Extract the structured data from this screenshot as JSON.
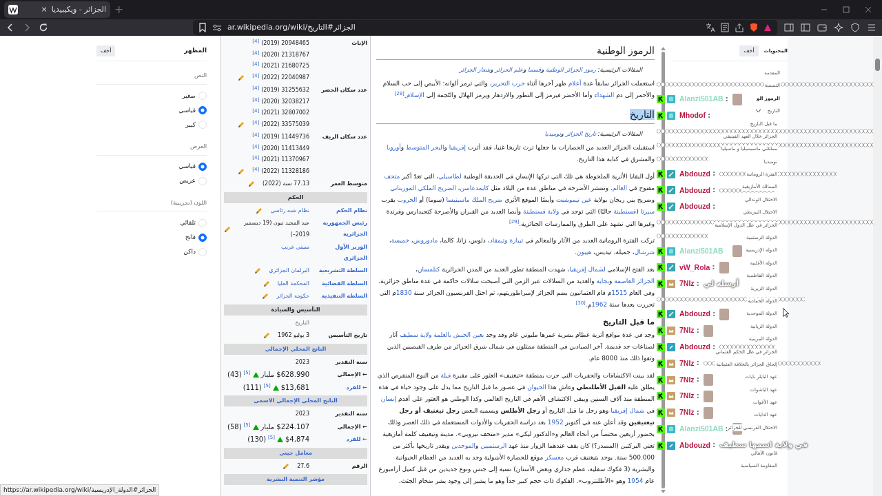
{
  "browser": {
    "tab": {
      "title": "الجزائر - ويكيبيديا",
      "close": "×",
      "new_tab": "+"
    },
    "url": "ar.wikipedia.org/wiki/الجزائر#التاريخ"
  },
  "appearance": {
    "title": "المظهر",
    "hide": "أخف",
    "groups": [
      {
        "title": "النص",
        "options": [
          {
            "label": "صغير",
            "selected": false
          },
          {
            "label": "قياسي",
            "selected": true
          },
          {
            "label": "كبير",
            "selected": false
          }
        ]
      },
      {
        "title": "العرض",
        "options": [
          {
            "label": "قياسي",
            "selected": true
          },
          {
            "label": "عريض",
            "selected": false
          }
        ]
      },
      {
        "title": "اللون (تجريبية)",
        "options": [
          {
            "label": "تلقائي",
            "selected": false
          },
          {
            "label": "فاتح",
            "selected": true
          },
          {
            "label": "داكن",
            "selected": false
          }
        ]
      }
    ]
  },
  "infobox": [
    {
      "kind": "row",
      "label": "الإناث",
      "values": [
        {
          "text": "20948465 (2019)",
          "ref": "[4]"
        },
        {
          "text": "21318767 (2020)",
          "ref": "[4]"
        },
        {
          "text": "21680725 (2021)",
          "ref": "[4]"
        },
        {
          "text": "22040987 (2022)",
          "ref": "[4]"
        }
      ],
      "edit": true
    },
    {
      "kind": "row",
      "label": "عدد سكان الحضر",
      "values": [
        {
          "text": "31255632 (2019)",
          "ref": "[4]"
        },
        {
          "text": "32038217 (2020)",
          "ref": "[4]"
        },
        {
          "text": "32807002 (2021)",
          "ref": "[4]"
        },
        {
          "text": "33575039 (2022)",
          "ref": "[4]"
        }
      ],
      "edit": true
    },
    {
      "kind": "row",
      "label": "عدد سكان الريف",
      "values": [
        {
          "text": "11449736 (2019)",
          "ref": "[4]"
        },
        {
          "text": "11413449 (2020)",
          "ref": "[4]"
        },
        {
          "text": "11370967 (2021)",
          "ref": "[4]"
        },
        {
          "text": "11328186 (2022)",
          "ref": "[4]"
        }
      ],
      "edit": true
    },
    {
      "kind": "row",
      "label": "متوسط العمر",
      "values": [
        {
          "text": "77.13 سنة (2022)"
        }
      ],
      "edit": true
    },
    {
      "kind": "header",
      "label": "الحكم",
      "link": false
    },
    {
      "kind": "row",
      "label": "نظام الحكم",
      "label_link": true,
      "values": [
        {
          "text": "نظام شبه رئاسي",
          "link": true
        }
      ],
      "edit": true
    },
    {
      "kind": "row",
      "label": "رئيس الجمهورية الجزائرية",
      "label_link": true,
      "values": [
        {
          "text": "عبد المجيد تبون (19 ديسمبر 2019–)"
        }
      ],
      "edit": true
    },
    {
      "kind": "row",
      "label": "الوزير الأول الجزائري",
      "label_link": true,
      "values": [
        {
          "text": "سيفي غريب",
          "link": true
        }
      ],
      "edit": false
    },
    {
      "kind": "row",
      "label": "السلطة التشريعية",
      "label_link": true,
      "values": [
        {
          "text": "البرلمان الجزائري",
          "link": true
        }
      ],
      "edit": true
    },
    {
      "kind": "row",
      "label": "السلطة القضائية",
      "label_link": true,
      "values": [
        {
          "text": "المحكمة العليا",
          "link": true
        }
      ],
      "edit": true
    },
    {
      "kind": "row",
      "label": "السلطة التنفيذية",
      "label_link": true,
      "values": [
        {
          "text": "حكومة الجزائر",
          "link": true
        }
      ],
      "edit": true
    },
    {
      "kind": "header",
      "label": "التأسيس والسيادة",
      "link": false
    },
    {
      "kind": "row",
      "values": [
        {
          "text": "التاريخ",
          "muted": true
        }
      ],
      "edit": false
    },
    {
      "kind": "row",
      "label": "تاريخ التأسيس",
      "values": [
        {
          "text": "3 يوليو 1962"
        }
      ],
      "edit": true
    },
    {
      "kind": "header",
      "label": "الناتج المحلي الإجمالي",
      "link": true
    },
    {
      "kind": "row",
      "label": "سنة التقدير",
      "values": [
        {
          "text": "2023"
        }
      ],
      "edit": false
    },
    {
      "kind": "stat",
      "label": "← الإجمالي",
      "values": [
        {
          "text": "$628.990 مليار",
          "trend_up": true,
          "ref": "[5]",
          "rank": "(43)"
        }
      ]
    },
    {
      "kind": "stat",
      "label": "← للفرد",
      "label_link": true,
      "values": [
        {
          "text": "$13,681",
          "trend_up": true,
          "ref": "[5]",
          "rank": "(111)"
        }
      ]
    },
    {
      "kind": "header",
      "label": "الناتج المحلي الإجمالي الاسمي",
      "link": true
    },
    {
      "kind": "row",
      "label": "سنة التقدير",
      "values": [
        {
          "text": "2023"
        }
      ],
      "edit": false
    },
    {
      "kind": "stat",
      "label": "← الإجمالي",
      "values": [
        {
          "text": "$224.107 مليار",
          "trend_up": true,
          "ref": "[5]",
          "rank": "(58)"
        }
      ]
    },
    {
      "kind": "stat",
      "label": "← للفرد",
      "label_link": true,
      "values": [
        {
          "text": "$4,874",
          "trend_up": true,
          "ref": "[5]",
          "rank": "(130)"
        }
      ]
    },
    {
      "kind": "header",
      "label": "معامل جيني",
      "link": true
    },
    {
      "kind": "row",
      "label": "الرقم",
      "values": [
        {
          "text": "27.6"
        }
      ],
      "edit": true
    },
    {
      "kind": "header",
      "label": "مؤشر التنمية البشرية",
      "link": true
    }
  ],
  "article": [
    {
      "kind": "h2",
      "text": "الرموز الوطنية",
      "highlighted": false
    },
    {
      "kind": "hatnote",
      "parts": [
        {
          "t": "المقالات الرئيسية: "
        },
        {
          "t": "رموز الجزائر الوطنية",
          "link": true
        },
        {
          "t": " و"
        },
        {
          "t": "قسما",
          "link": true
        },
        {
          "t": " و"
        },
        {
          "t": "علم الجزائر",
          "link": true
        },
        {
          "t": " و"
        },
        {
          "t": "شعار الجزائر",
          "link": true
        }
      ]
    },
    {
      "kind": "p",
      "parts": [
        {
          "t": "استعملت الجزائر سابقاً عدة "
        },
        {
          "t": "أعلام",
          "link": true
        },
        {
          "t": " ظهر آخرها أثناء "
        },
        {
          "t": "حرب التحرير",
          "link": true
        },
        {
          "t": "، والتي ترمز ألوانه: الأبيض إلى حب السلام والأحمر إلى دم "
        },
        {
          "t": "الشهداء",
          "link": true
        },
        {
          "t": " وأما الأخضر فيرمز إلى التطور والازدهار ويرمز الهلال والنّجمة إلى "
        },
        {
          "t": "الإسلام",
          "link": true
        },
        {
          "t": ".$^{[28]}$"
        }
      ]
    },
    {
      "kind": "h2",
      "text": "التاريخ",
      "highlighted": true
    },
    {
      "kind": "hatnote",
      "parts": [
        {
          "t": "المقالات الرئيسية: "
        },
        {
          "t": "تاريخ الجزائر",
          "link": true
        },
        {
          "t": " و"
        },
        {
          "t": "نوميديا",
          "link": true
        }
      ]
    },
    {
      "kind": "p",
      "parts": [
        {
          "t": "استقبلت الجزائر العديد من الحضارات ما جعلها ترث تاريخا غنيا، فقد أثرت "
        },
        {
          "t": "إفريقيا",
          "link": true
        },
        {
          "t": " و"
        },
        {
          "t": "البحر المتوسط",
          "link": true
        },
        {
          "t": " و"
        },
        {
          "t": "أوروبا",
          "link": true
        },
        {
          "t": " والمشرق في كتابة هذا التاريخ."
        }
      ]
    },
    {
      "kind": "p",
      "parts": [
        {
          "t": "أول البقايا الأثرية الملحوظة هي تلك التي تركها الإنسان في الحديقة الوطنية "
        },
        {
          "t": "لطاسيلي",
          "link": true
        },
        {
          "t": "، التي تعدّ أكبر "
        },
        {
          "t": "متحف",
          "link": true
        },
        {
          "t": " مفتوح في "
        },
        {
          "t": "العالم",
          "link": true
        },
        {
          "t": ". وتنتشر الأضرحة في مناطق عدة من البلاد مثل "
        },
        {
          "t": "كايمدعاسن",
          "link": true
        },
        {
          "t": "، "
        },
        {
          "t": "الضريح الملكي الموريتاني",
          "link": true
        },
        {
          "t": " وضريح بني ربحان بولاية "
        },
        {
          "t": "عين تيموشنت",
          "link": true
        },
        {
          "t": " وأيضًا الموقع الأثري "
        },
        {
          "t": "ضريح الملك ماسينيسا",
          "link": true
        },
        {
          "t": " (سوما) أو "
        },
        {
          "t": "الخروب",
          "link": true
        },
        {
          "t": " بقرب "
        },
        {
          "t": "سيرتا",
          "link": true
        },
        {
          "t": " ("
        },
        {
          "t": "قسنطينة",
          "link": true
        },
        {
          "t": " حاليًا) التي توجد في "
        },
        {
          "t": "ولاية قسنطينة",
          "link": true
        },
        {
          "t": " وأيضا العديد من القبران والأضرحة كتجيدارس وفرندة وغيرها التي تشهد على الطرق والممارسات الجنائزية.$^{[29]}$"
        }
      ]
    },
    {
      "kind": "p",
      "parts": [
        {
          "t": "تركت الفترة الرومانية العديد من الآثار والمعالم في "
        },
        {
          "t": "تيبازة وتيمقاد",
          "link": true
        },
        {
          "t": "، دلوس، زانا، كالما، "
        },
        {
          "t": "مادوروش",
          "link": true
        },
        {
          "t": "، "
        },
        {
          "t": "خميسة",
          "link": true
        },
        {
          "t": "، "
        },
        {
          "t": "شرشال",
          "link": true
        },
        {
          "t": "، جميلة، تيديس، "
        },
        {
          "t": "هيبون",
          "link": true
        },
        {
          "t": "."
        }
      ]
    },
    {
      "kind": "p",
      "parts": [
        {
          "t": "بعد الفتح الإسلامي "
        },
        {
          "t": "لشمال إفريقيا",
          "link": true
        },
        {
          "t": "، شهدت المنطقة تطور العديد من المدن الجزائرية "
        },
        {
          "t": "كتلمسان",
          "link": true
        },
        {
          "t": "، "
        },
        {
          "t": "الجزائر العاصمة",
          "link": true
        },
        {
          "t": " و"
        },
        {
          "t": "بجاية",
          "link": true
        },
        {
          "t": " والعديد من السلالات عبر الزمن التي أصبحت سلالات حاكمة في عدة مناطق جزائرية. وفي العام "
        },
        {
          "t": "1515",
          "link": true
        },
        {
          "t": "م قام العثمانيون بضم الجزائر لإمبراطوريتهم، ثم احتل الفرنسيون الجزائر سنة "
        },
        {
          "t": "1830",
          "link": true
        },
        {
          "t": "م التي تحررت بعدها سنة "
        },
        {
          "t": "1962",
          "link": true
        },
        {
          "t": "م.$^{[30]}$"
        }
      ]
    },
    {
      "kind": "h3",
      "text": "ما قبل التاريخ"
    },
    {
      "kind": "p",
      "parts": [
        {
          "t": "وجد في عدة مواقع أثرية عظام بشرية عمرها مليوني عام وقد وجد "
        },
        {
          "t": "بعين الحنش",
          "link": true
        },
        {
          "t": "بالعلمة",
          "link": true,
          "space_before": true
        },
        {
          "t": "ولاية سطيف",
          "link": true,
          "space_before": true
        },
        {
          "t": " آثار لصناعات جد قديمة. آخر الصيادين في المنطقة ممثلون في شمال شرق الجزائر من طرف القبصيين الذين وثقوا ذلك منذ 8000 عام."
        }
      ]
    },
    {
      "kind": "p",
      "parts": [
        {
          "t": "لقد بينت الاكتشافات والحفريات التي جرت بمنطقة «تيغنيف» العثور على مقبرة "
        },
        {
          "t": "فيلة",
          "link": true
        },
        {
          "t": " من النوع المنقرض الذي يطلق عليه **الفيل الأطلنطي** وعاش هذا "
        },
        {
          "t": "الحيوان",
          "link": true
        },
        {
          "t": " في عصور ما قبل التاريخ مما يدل على وجود حياة في هذه المنطقة منذ آلاف السنين ويبقى الاكتشاف الأهم في التاريخ العالمي وكذا الوطني هو العثور على أقدم "
        },
        {
          "t": "إنسان",
          "link": true
        },
        {
          "t": " في "
        },
        {
          "t": "شمال إفريقيا",
          "link": true
        },
        {
          "t": " وهو رجل ما قبل التاريخ أو **رجل الأطلس** ويسميه البعض **رجل تيغنيف أو رجل تيغنيفين** وقد أعلن عنه في أكتوبر "
        },
        {
          "t": "1952",
          "link": true
        },
        {
          "t": " بعد دراسة الحفريات والأدوات المستعملة في ذلك العصر وذلك بحضور أربعين مختصاً من أنحاء العالم و«الدكتور ليكي» مدير «متحف نيروبي». مدينة وتيغنيف كلمة أمازيغية تعني البركتين (المصدر؟) كان يقف عندهما الزوار منذ عهد "
        },
        {
          "t": "الرستميين",
          "link": true
        },
        {
          "t": " و"
        },
        {
          "t": "الموحدين",
          "link": true
        },
        {
          "t": " ويقدر تاريخها بأكثر من 500.000 سنة. يوجد بتيغنيف قرب "
        },
        {
          "t": "معسكر",
          "link": true
        },
        {
          "t": " موقع للحضارة الأشولية وجد به العديد من العظام الحيوانية والبشرية (3 فكوك سفلية، عظم جداري وبعض الأسنان) نسبة إلى جنس ونوع جديدين من قبل كميل أرامبورغ عام "
        },
        {
          "t": "1954",
          "link": true
        },
        {
          "t": " وهو «الأطلنتروب». الفكوك ذات حجم كبير جداً وهو ما يشير إلى وجود بشر ضخام الجثث."
        }
      ]
    }
  ],
  "toc": {
    "title": "المحتويات",
    "hide": "أخف",
    "items": [
      {
        "label": "المقدمة",
        "current": false
      },
      {
        "label": "التسمية",
        "current": false
      },
      {
        "label": "الرموز الو",
        "current": true
      },
      {
        "label": "التاريخ",
        "current": false,
        "expanded": true,
        "children": [
          {
            "label": "ما قبل التاريخ"
          },
          {
            "label": "الجزائر خلال العهد الفينيقي"
          },
          {
            "label": "مملكتي ماسيسيليا و ماسيليا"
          },
          {
            "label": "نوميديا"
          },
          {
            "label": "الفترة الرومانية"
          },
          {
            "label": "الممالك الأمازيغية"
          },
          {
            "label": "الاحتلال الوندالي"
          },
          {
            "label": "الاحتلال البيزنطي"
          },
          {
            "label": "الجزائر في ظل الدول الإسلامية"
          },
          {
            "label": "الدولة الرستمية"
          },
          {
            "label": "الدولة الإدريسية"
          },
          {
            "label": "الدولة الأغلبية"
          },
          {
            "label": "الدولة الفاطمية"
          },
          {
            "label": "الدولة الزيرية"
          },
          {
            "label": "الدولة الحمادية"
          },
          {
            "label": "الدولة الموحدية"
          },
          {
            "label": "الدولة الزيانية"
          },
          {
            "label": "الدولة المرينية"
          },
          {
            "label": "الجزائر في ظل الحكم العثماني"
          },
          {
            "label": "إلحاق الجزائر بالخلافة العثمانية"
          },
          {
            "label": "عهد البايلر بايات"
          },
          {
            "label": "عهد الباشوات"
          },
          {
            "label": "عهد الأغوات"
          },
          {
            "label": "عهد الدايات"
          },
          {
            "label": "الاحتلال الفرنسي للجزائر"
          },
          {
            "label": "قانون الأهالي",
            "gap_before": true
          },
          {
            "label": "المقاومة السياسية"
          }
        ]
      }
    ]
  },
  "chat": [
    {
      "kind": "emotes-long"
    },
    {
      "kind": "message",
      "user": "Alanzi501AB",
      "color": "#8fdcc0",
      "badges": [
        {
          "kind": "kick"
        },
        {
          "kind": "sub"
        }
      ],
      "sep": ":",
      "body": {
        "kind": "emote-image"
      }
    },
    {
      "kind": "message",
      "user": "Mhodof",
      "color": "#b8143f",
      "badges": [
        {
          "kind": "kick"
        },
        {
          "kind": "sub"
        }
      ],
      "sep": ":"
    },
    {
      "kind": "emotes-long"
    },
    {
      "kind": "emotes-long"
    },
    {
      "kind": "emotes-short"
    },
    {
      "kind": "message",
      "user": "Abdouzd",
      "color": "#b8143f",
      "badges": [
        {
          "kind": "kick"
        },
        {
          "kind": "mod"
        }
      ],
      "sep": ":",
      "body": {
        "kind": "emote-strip"
      }
    },
    {
      "kind": "message",
      "user": "Abdouzd",
      "color": "#b8143f",
      "badges": [
        {
          "kind": "kick"
        },
        {
          "kind": "mod"
        }
      ],
      "sep": ":",
      "body": {
        "kind": "emote-strip-short"
      }
    },
    {
      "kind": "message",
      "user": "Abdouzd",
      "color": "#b8143f",
      "badges": [
        {
          "kind": "kick"
        },
        {
          "kind": "mod"
        }
      ],
      "sep": ":"
    },
    {
      "kind": "emotes-long"
    },
    {
      "kind": "emotes-short"
    },
    {
      "kind": "message",
      "user": "Alanzi501AB",
      "color": "#8fdcc0",
      "badges": [
        {
          "kind": "kick"
        },
        {
          "kind": "sub"
        }
      ],
      "body": {
        "kind": "emote-image"
      }
    },
    {
      "kind": "message",
      "user": "vW_Rola",
      "color": "#c2185b",
      "badges": [
        {
          "kind": "kick"
        },
        {
          "kind": "mod"
        }
      ],
      "sep": ":",
      "body": {
        "kind": "emote-image"
      }
    },
    {
      "kind": "message",
      "user": "7Nlz",
      "color": "#b8143f",
      "badges": [
        {
          "kind": "kick"
        },
        {
          "kind": "crown"
        }
      ],
      "sep": ":",
      "body": {
        "kind": "text",
        "text": "أرسله لي"
      }
    },
    {
      "kind": "emotes-mid"
    },
    {
      "kind": "message",
      "user": "Abdouzd",
      "color": "#b8143f",
      "badges": [
        {
          "kind": "kick"
        },
        {
          "kind": "mod"
        }
      ],
      "sep": ":",
      "body": {
        "kind": "emote-image"
      }
    },
    {
      "kind": "message",
      "user": "7Nlz",
      "color": "#b8143f",
      "badges": [
        {
          "kind": "kick"
        },
        {
          "kind": "crown"
        }
      ],
      "sep": ":",
      "body": {
        "kind": "emote-image"
      }
    },
    {
      "kind": "message",
      "user": "Abdouzd",
      "color": "#b8143f",
      "badges": [
        {
          "kind": "kick"
        },
        {
          "kind": "pen"
        }
      ],
      "sep": ":",
      "body": {
        "kind": "emote-strip-short"
      }
    },
    {
      "kind": "message",
      "user": "7Nlz",
      "color": "#b8143f",
      "badges": [
        {
          "kind": "kick"
        },
        {
          "kind": "crown"
        }
      ],
      "sep": ":",
      "body": {
        "kind": "emote-strip"
      }
    },
    {
      "kind": "message",
      "user": "7Nlz",
      "color": "#b8143f",
      "badges": [
        {
          "kind": "kick"
        },
        {
          "kind": "crown"
        }
      ],
      "sep": ":",
      "body": {
        "kind": "emote-image"
      }
    },
    {
      "kind": "message",
      "user": "7Nlz",
      "color": "#b8143f",
      "badges": [
        {
          "kind": "kick"
        },
        {
          "kind": "crown"
        }
      ],
      "sep": ":",
      "body": {
        "kind": "emote-image"
      }
    },
    {
      "kind": "message",
      "user": "7Nlz",
      "color": "#b8143f",
      "badges": [
        {
          "kind": "kick"
        },
        {
          "kind": "crown"
        }
      ],
      "sep": ":",
      "body": {
        "kind": "emote-image"
      }
    },
    {
      "kind": "message",
      "user": "Alanzi501AB",
      "color": "#8fdcc0",
      "badges": [
        {
          "kind": "kick"
        },
        {
          "kind": "sub"
        }
      ],
      "sep": ":",
      "body": {
        "kind": "emote-image"
      }
    },
    {
      "kind": "message",
      "user": "Abdouzd",
      "color": "#b8143f",
      "badges": [
        {
          "kind": "kick"
        },
        {
          "kind": "pen"
        }
      ],
      "sep": ":",
      "body": {
        "kind": "text",
        "text": "في ولاية اسمها سطيف"
      }
    }
  ],
  "status_link": "https://ar.wikipedia.org/wiki/الجزائر#الدولة_الإدريسية"
}
